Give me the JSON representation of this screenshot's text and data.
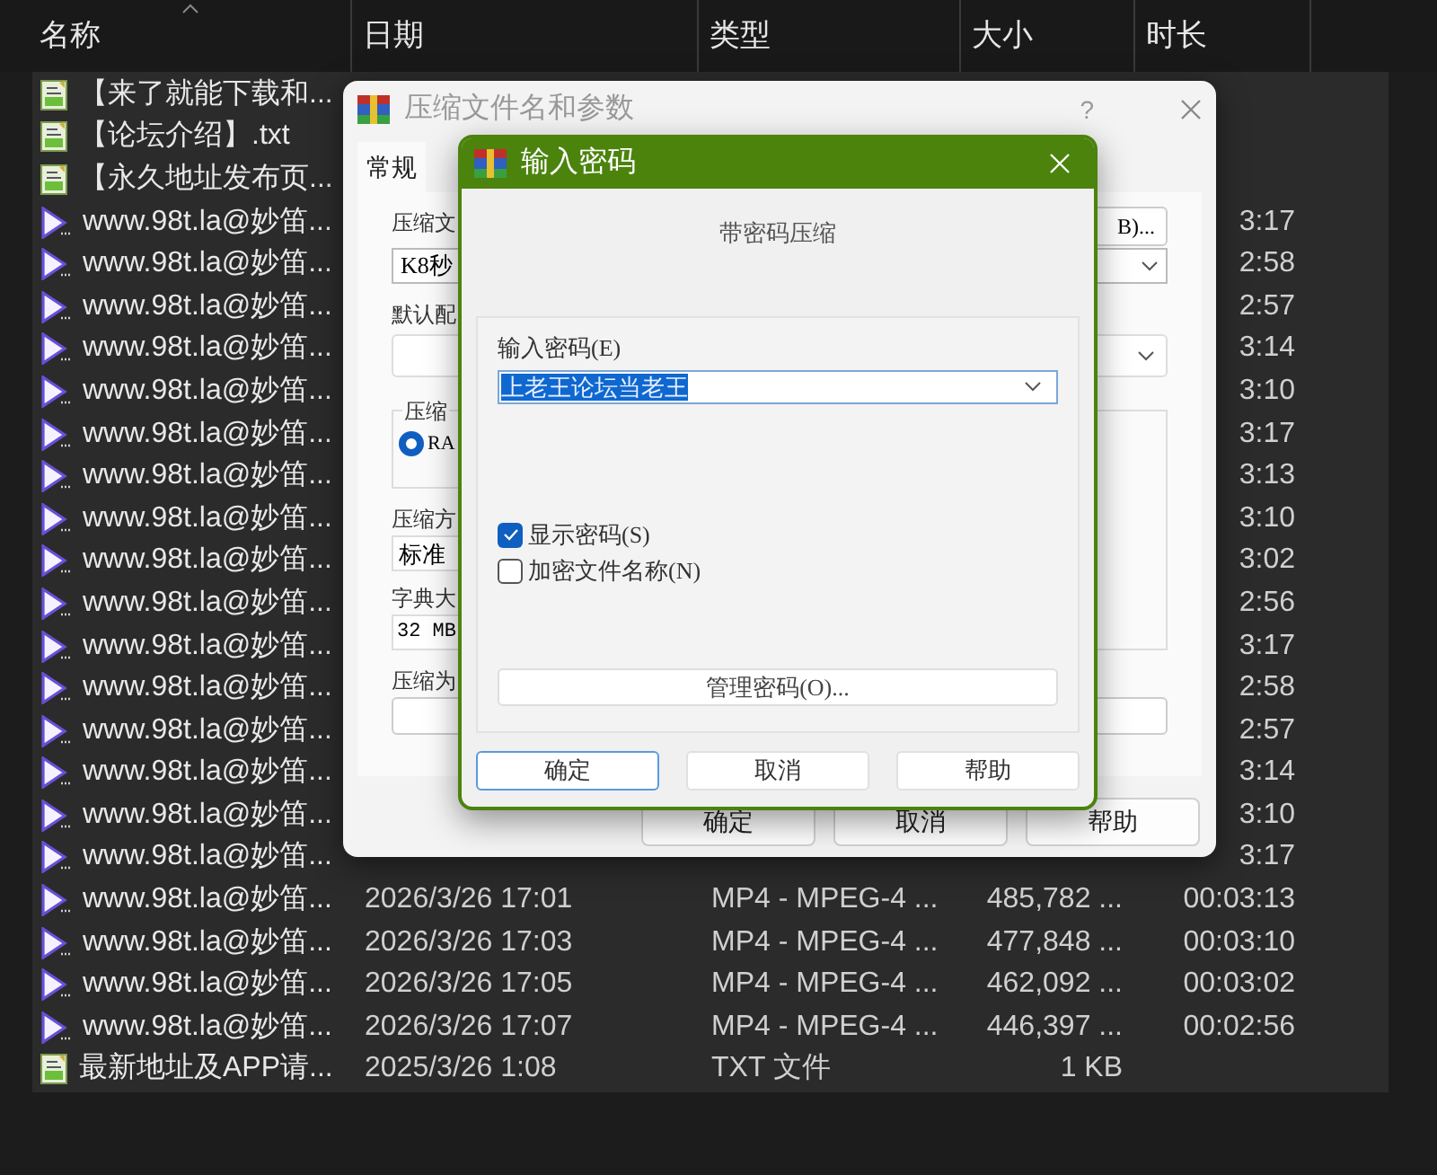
{
  "file_list": {
    "columns": [
      "名称",
      "日期",
      "类型",
      "大小",
      "时长"
    ],
    "rows": [
      {
        "kind": "text",
        "name": "【来了就能下载和..."
      },
      {
        "kind": "text",
        "name": "【论坛介绍】.txt"
      },
      {
        "kind": "text",
        "name": "【永久地址发布页..."
      },
      {
        "kind": "video",
        "name": "www.98t.la@妙笛...",
        "duration": "3:17"
      },
      {
        "kind": "video",
        "name": "www.98t.la@妙笛...",
        "duration": "2:58"
      },
      {
        "kind": "video",
        "name": "www.98t.la@妙笛...",
        "duration": "2:57"
      },
      {
        "kind": "video",
        "name": "www.98t.la@妙笛...",
        "duration": "3:14"
      },
      {
        "kind": "video",
        "name": "www.98t.la@妙笛...",
        "duration": "3:10"
      },
      {
        "kind": "video",
        "name": "www.98t.la@妙笛...",
        "duration": "3:17"
      },
      {
        "kind": "video",
        "name": "www.98t.la@妙笛...",
        "duration": "3:13"
      },
      {
        "kind": "video",
        "name": "www.98t.la@妙笛...",
        "duration": "3:10"
      },
      {
        "kind": "video",
        "name": "www.98t.la@妙笛...",
        "duration": "3:02"
      },
      {
        "kind": "video",
        "name": "www.98t.la@妙笛...",
        "duration": "2:56"
      },
      {
        "kind": "video",
        "name": "www.98t.la@妙笛...",
        "duration": "3:17"
      },
      {
        "kind": "video",
        "name": "www.98t.la@妙笛...",
        "duration": "2:58"
      },
      {
        "kind": "video",
        "name": "www.98t.la@妙笛...",
        "duration": "2:57"
      },
      {
        "kind": "video",
        "name": "www.98t.la@妙笛...",
        "duration": "3:14"
      },
      {
        "kind": "video",
        "name": "www.98t.la@妙笛...",
        "duration": "3:10"
      },
      {
        "kind": "video",
        "name": "www.98t.la@妙笛...",
        "duration": "3:17"
      },
      {
        "kind": "video",
        "name": "www.98t.la@妙笛...",
        "date": "2026/3/26 17:01",
        "type": "MP4 - MPEG-4 ...",
        "size": "485,782 ...",
        "duration": "00:03:13"
      },
      {
        "kind": "video",
        "name": "www.98t.la@妙笛...",
        "date": "2026/3/26 17:03",
        "type": "MP4 - MPEG-4 ...",
        "size": "477,848 ...",
        "duration": "00:03:10"
      },
      {
        "kind": "video",
        "name": "www.98t.la@妙笛...",
        "date": "2026/3/26 17:05",
        "type": "MP4 - MPEG-4 ...",
        "size": "462,092 ...",
        "duration": "00:03:02"
      },
      {
        "kind": "video",
        "name": "www.98t.la@妙笛...",
        "date": "2026/3/26 17:07",
        "type": "MP4 - MPEG-4 ...",
        "size": "446,397 ...",
        "duration": "00:02:56"
      },
      {
        "kind": "text",
        "name": "最新地址及APP请...",
        "date": "2025/3/26 1:08",
        "type": "TXT 文件",
        "size": "1 KB"
      }
    ]
  },
  "archive_dialog": {
    "title": "压缩文件名和参数",
    "help": "?",
    "tabs": [
      {
        "label": "常规",
        "selected": true
      }
    ],
    "archive_name_label": "压缩文",
    "browse_button": "B)...",
    "archive_name": "K8秒",
    "profile_label": "默认配",
    "format_group_label": "压缩",
    "format_options": [
      {
        "label": "RA",
        "selected": true
      }
    ],
    "method_label": "压缩方",
    "method": "标准",
    "dictionary_label": "字典大",
    "dictionary": "32 MB",
    "split_label": "压缩为",
    "buttons": [
      "确定",
      "取消",
      "帮助"
    ]
  },
  "password_dialog": {
    "title": "输入密码",
    "heading": "带密码压缩",
    "password_label": "输入密码(E)",
    "password": "上老王论坛当老王",
    "password_selected": true,
    "options": [
      {
        "label": "显示密码(S)",
        "checked": true
      },
      {
        "label": "加密文件名称(N)",
        "checked": false
      }
    ],
    "manage_button": "管理密码(O)...",
    "buttons": [
      {
        "label": "确定",
        "default": true
      },
      {
        "label": "取消",
        "default": false
      },
      {
        "label": "帮助",
        "default": false
      }
    ]
  }
}
